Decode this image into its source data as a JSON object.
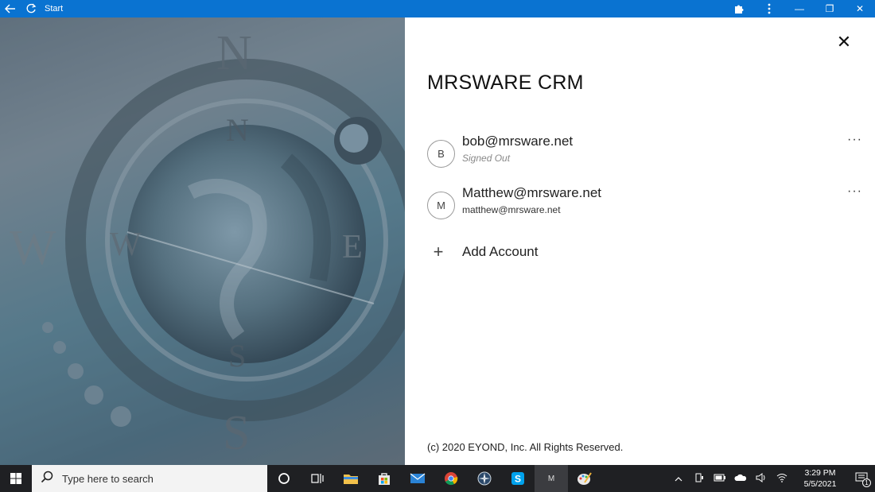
{
  "titlebar": {
    "title": "Start",
    "back_icon": "back-arrow-icon",
    "refresh_icon": "refresh-icon",
    "extension_icon": "puzzle-icon",
    "menu_icon": "kebab-menu-icon",
    "minimize": "—",
    "restore": "❐",
    "close": "✕"
  },
  "panel": {
    "app_title": "MRSWARE CRM",
    "close": "✕",
    "accounts": [
      {
        "initial": "B",
        "name": "bob@mrsware.net",
        "sub": "Signed Out",
        "more": "···"
      },
      {
        "initial": "M",
        "name": "Matthew@mrsware.net",
        "sub": "matthew@mrsware.net",
        "more": "···"
      }
    ],
    "add_account": {
      "icon": "+",
      "label": "Add Account"
    },
    "copyright": "(c) 2020 EYOND, Inc. All Rights Reserved."
  },
  "hero": {
    "compass_letters": [
      "N",
      "N",
      "W",
      "W",
      "E",
      "S",
      "S"
    ]
  },
  "taskbar": {
    "search_placeholder": "Type here to search",
    "app_m_label": "M",
    "time": "3:29 PM",
    "date": "5/5/2021",
    "notification_count": "1"
  },
  "colors": {
    "titlebar": "#0a73d1",
    "taskbar": "#1f2023"
  }
}
